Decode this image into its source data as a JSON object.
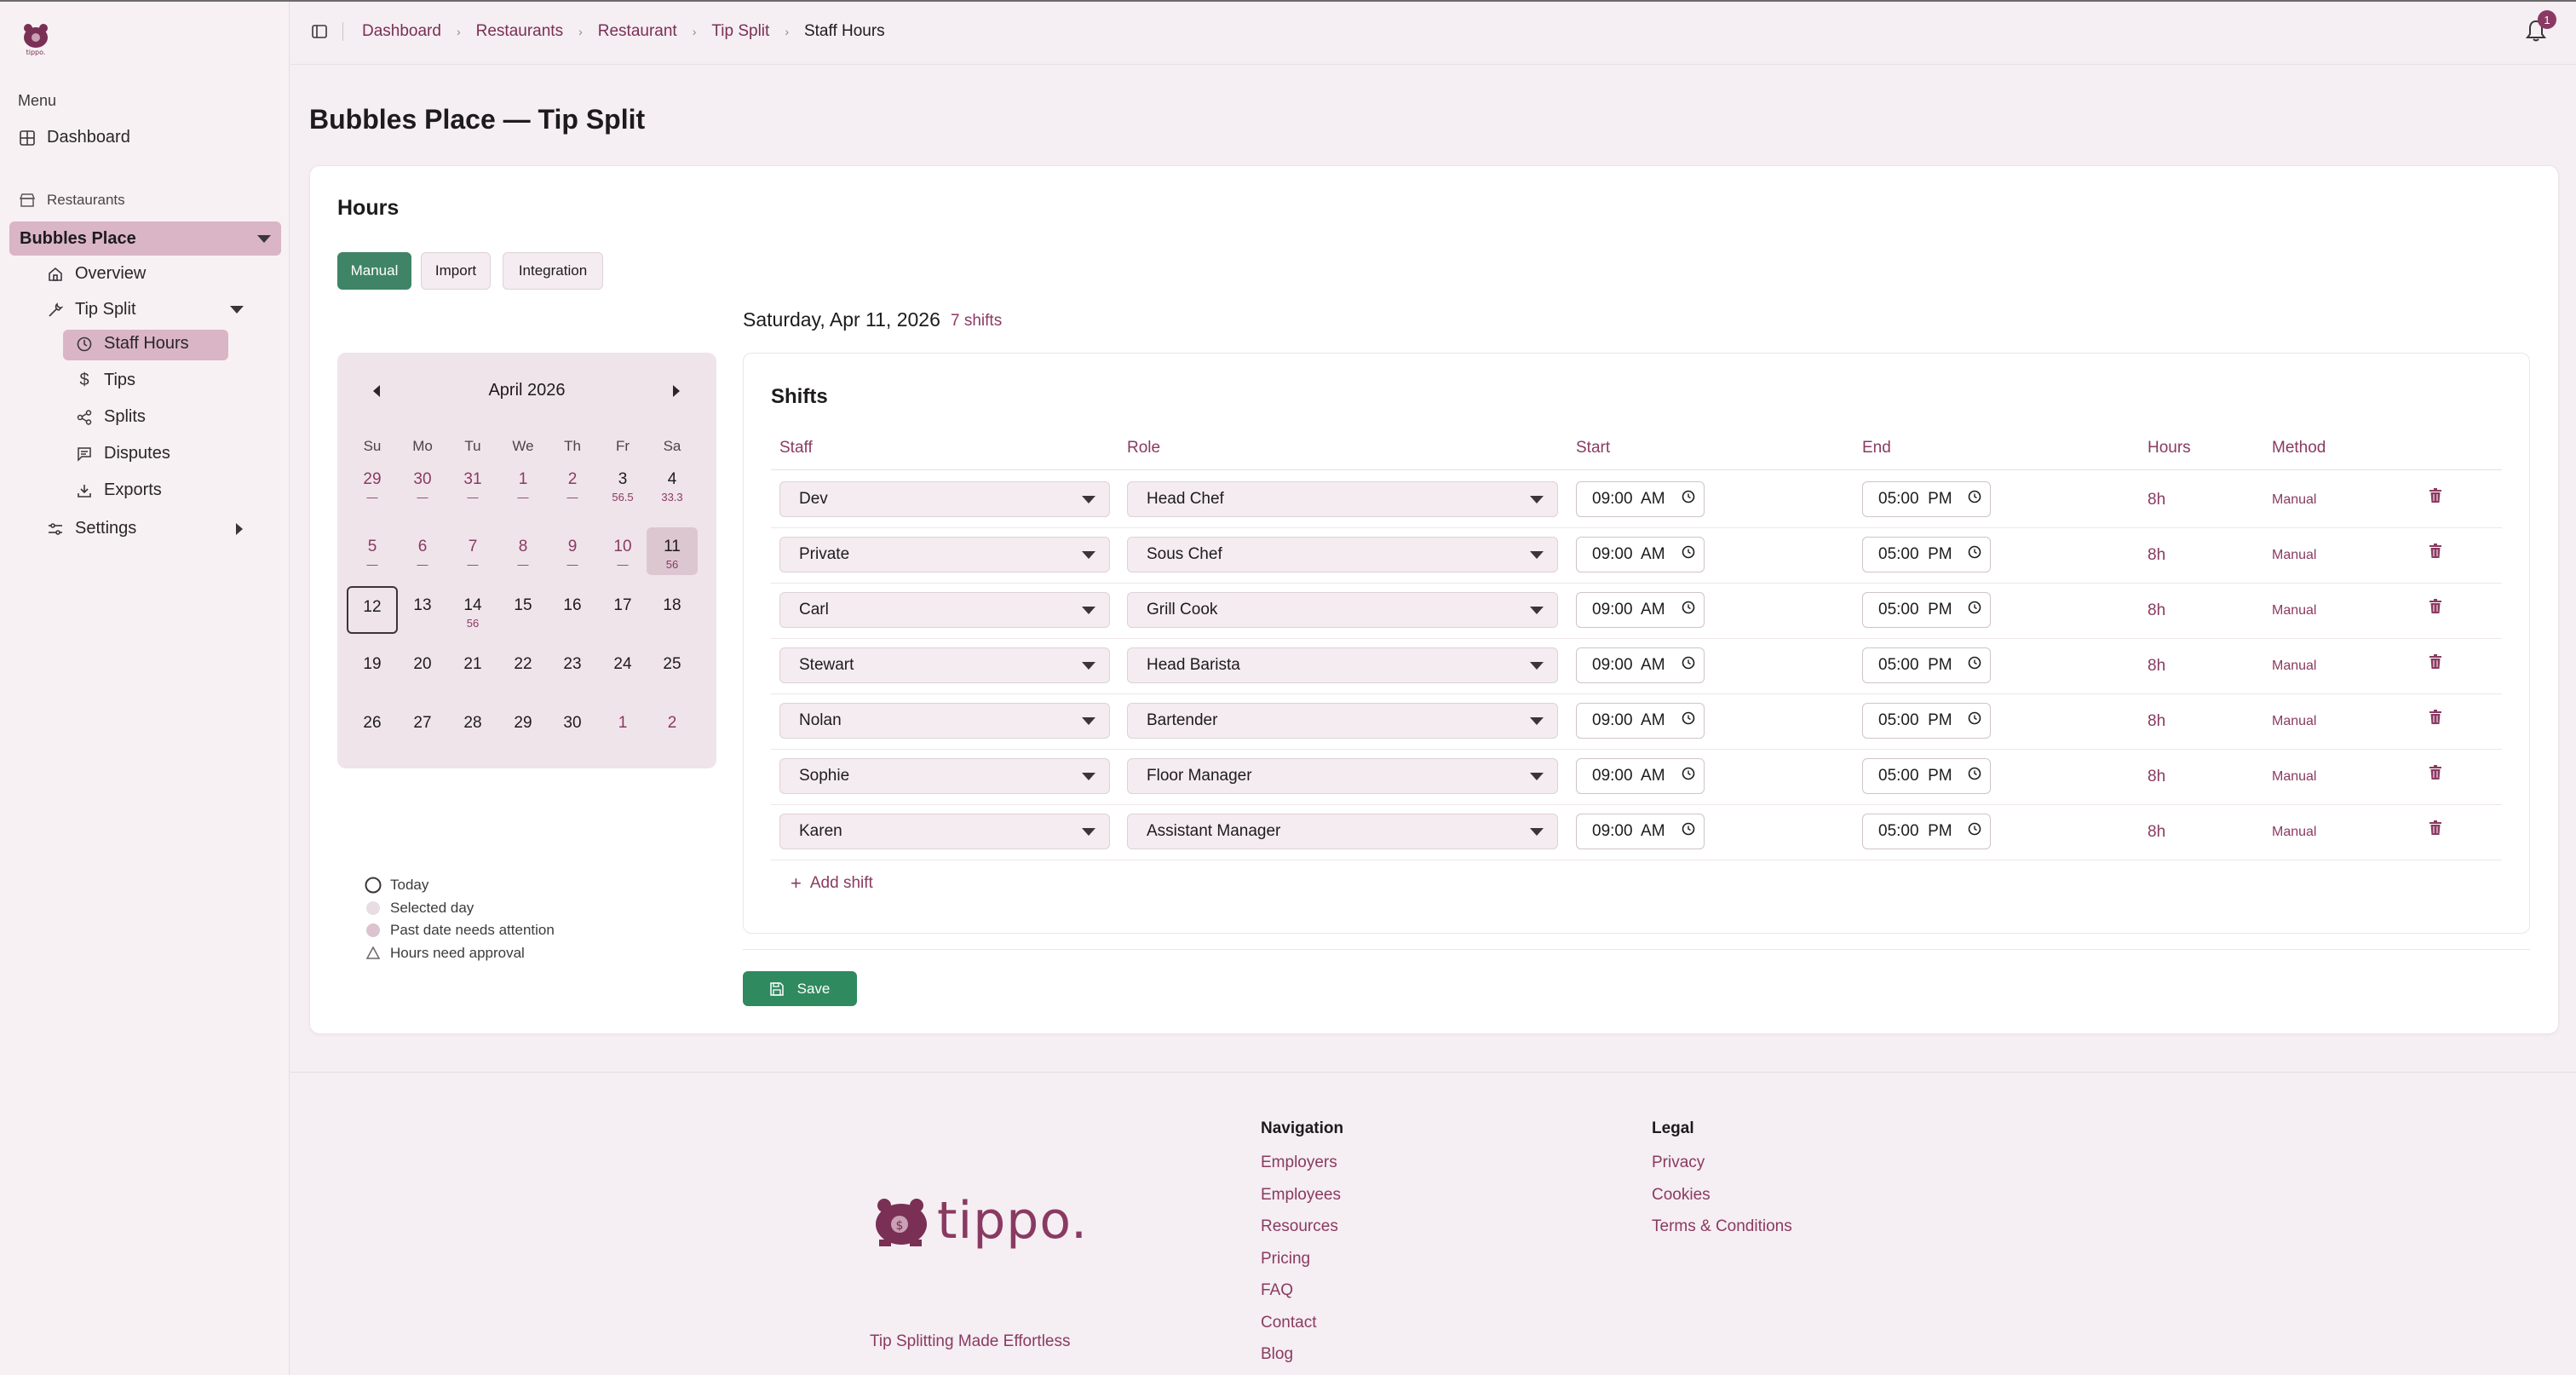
{
  "sidebar": {
    "menu_label": "Menu",
    "dashboard": "Dashboard",
    "restaurants_label": "Restaurants",
    "restaurant_name": "Bubbles Place",
    "overview": "Overview",
    "tip_split": "Tip Split",
    "staff_hours": "Staff Hours",
    "tips": "Tips",
    "splits": "Splits",
    "disputes": "Disputes",
    "exports": "Exports",
    "settings": "Settings"
  },
  "breadcrumb": [
    "Dashboard",
    "Restaurants",
    "Restaurant",
    "Tip Split",
    "Staff Hours"
  ],
  "notifications": {
    "count": "1"
  },
  "page_title": "Bubbles Place — Tip Split",
  "hours_card": {
    "title": "Hours",
    "tabs": [
      "Manual",
      "Import",
      "Integration"
    ],
    "active_tab": "Manual"
  },
  "calendar": {
    "month": "April 2026",
    "dow": [
      "Su",
      "Mo",
      "Tu",
      "We",
      "Th",
      "Fr",
      "Sa"
    ],
    "weeks": [
      [
        {
          "d": "29",
          "s": "—",
          "past": true
        },
        {
          "d": "30",
          "s": "—",
          "past": true
        },
        {
          "d": "31",
          "s": "—",
          "past": true
        },
        {
          "d": "1",
          "s": "—",
          "past": true
        },
        {
          "d": "2",
          "s": "—",
          "past": true
        },
        {
          "d": "3",
          "s": "56.5"
        },
        {
          "d": "4",
          "s": "33.3"
        }
      ],
      [
        {
          "d": "5",
          "s": "—",
          "past": true
        },
        {
          "d": "6",
          "s": "—",
          "past": true
        },
        {
          "d": "7",
          "s": "—",
          "past": true
        },
        {
          "d": "8",
          "s": "—",
          "past": true
        },
        {
          "d": "9",
          "s": "—",
          "past": true
        },
        {
          "d": "10",
          "s": "—",
          "past": true
        },
        {
          "d": "11",
          "s": "56",
          "selected": true
        }
      ],
      [
        {
          "d": "12",
          "s": "",
          "today": true
        },
        {
          "d": "13",
          "s": ""
        },
        {
          "d": "14",
          "s": "56"
        },
        {
          "d": "15",
          "s": ""
        },
        {
          "d": "16",
          "s": ""
        },
        {
          "d": "17",
          "s": ""
        },
        {
          "d": "18",
          "s": ""
        }
      ],
      [
        {
          "d": "19",
          "s": ""
        },
        {
          "d": "20",
          "s": ""
        },
        {
          "d": "21",
          "s": ""
        },
        {
          "d": "22",
          "s": ""
        },
        {
          "d": "23",
          "s": ""
        },
        {
          "d": "24",
          "s": ""
        },
        {
          "d": "25",
          "s": ""
        }
      ],
      [
        {
          "d": "26",
          "s": ""
        },
        {
          "d": "27",
          "s": ""
        },
        {
          "d": "28",
          "s": ""
        },
        {
          "d": "29",
          "s": ""
        },
        {
          "d": "30",
          "s": ""
        },
        {
          "d": "1",
          "s": "",
          "past": true
        },
        {
          "d": "2",
          "s": "",
          "past": true
        }
      ]
    ]
  },
  "legend": [
    "Today",
    "Selected day",
    "Past date needs attention",
    "Hours need approval"
  ],
  "shifts": {
    "date_heading": "Saturday, Apr 11, 2026",
    "count": "7 shifts",
    "title": "Shifts",
    "headers": {
      "staff": "Staff",
      "role": "Role",
      "start": "Start",
      "end": "End",
      "hours": "Hours",
      "method": "Method"
    },
    "rows": [
      {
        "staff": "Dev",
        "role": "Head Chef",
        "start": "09:00  AM",
        "end": "05:00  PM",
        "hours": "8h",
        "method": "Manual"
      },
      {
        "staff": "Private",
        "role": "Sous Chef",
        "start": "09:00  AM",
        "end": "05:00  PM",
        "hours": "8h",
        "method": "Manual"
      },
      {
        "staff": "Carl",
        "role": "Grill Cook",
        "start": "09:00  AM",
        "end": "05:00  PM",
        "hours": "8h",
        "method": "Manual"
      },
      {
        "staff": "Stewart",
        "role": "Head Barista",
        "start": "09:00  AM",
        "end": "05:00  PM",
        "hours": "8h",
        "method": "Manual"
      },
      {
        "staff": "Nolan",
        "role": "Bartender",
        "start": "09:00  AM",
        "end": "05:00  PM",
        "hours": "8h",
        "method": "Manual"
      },
      {
        "staff": "Sophie",
        "role": "Floor Manager",
        "start": "09:00  AM",
        "end": "05:00  PM",
        "hours": "8h",
        "method": "Manual"
      },
      {
        "staff": "Karen",
        "role": "Assistant Manager",
        "start": "09:00  AM",
        "end": "05:00  PM",
        "hours": "8h",
        "method": "Manual"
      }
    ],
    "add_label": "Add shift",
    "save_label": "Save"
  },
  "footer": {
    "logo_text": "tippo.",
    "tagline": "Tip Splitting Made Effortless",
    "navigation_heading": "Navigation",
    "navigation": [
      "Employers",
      "Employees",
      "Resources",
      "Pricing",
      "FAQ",
      "Contact",
      "Blog"
    ],
    "legal_heading": "Legal",
    "legal": [
      "Privacy",
      "Cookies",
      "Terms & Conditions"
    ]
  },
  "colors": {
    "accent": "#8a3a62",
    "active_pill": "#d9b5c6",
    "manual_tab": "#3f8466",
    "save_button": "#2f8a5f",
    "background": "#f5eef2"
  }
}
